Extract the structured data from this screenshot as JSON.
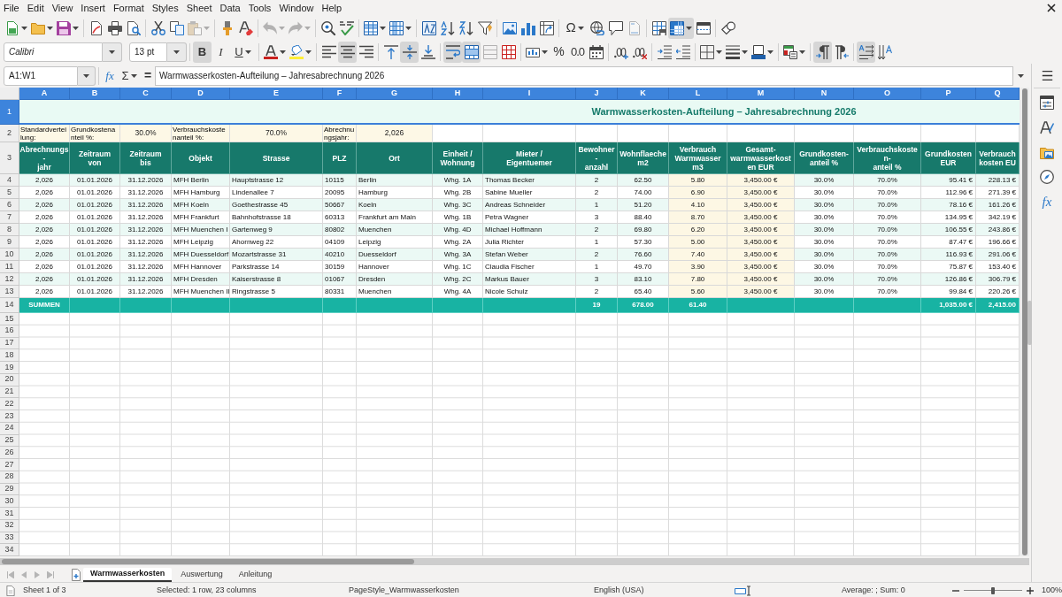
{
  "menu_bar": [
    "File",
    "Edit",
    "View",
    "Insert",
    "Format",
    "Styles",
    "Sheet",
    "Data",
    "Tools",
    "Window",
    "Help"
  ],
  "standard_toolbar": {
    "special_character_label": "Ω",
    "pressed": {
      "freeze_rows_columns": true
    },
    "disabled": {
      "paste": true,
      "undo": true,
      "redo": true,
      "header_footer": true
    }
  },
  "formatting_toolbar": {
    "font_name": "Calibri",
    "font_size": "13 pt",
    "bold_label": "B",
    "italic_label": "I",
    "underline_label": "U",
    "percent_label": "%",
    "number_label": "0.0",
    "pressed": {
      "bold": true,
      "italic": false,
      "underline": false,
      "align_left": false,
      "align_center": true,
      "align_right": false,
      "align_top": false,
      "align_middle": true,
      "align_bottom": false,
      "wrap_text": true,
      "merge_and_center": true,
      "left_to_right": true,
      "right_to_left": false,
      "text_horizontal": true,
      "text_vertical": false
    },
    "disabled": {
      "merge_cells": true
    }
  },
  "formula_bar": {
    "name_box": "A1:W1",
    "function_wizard_label": "fx",
    "sum_label": "Σ",
    "formula_label": "=",
    "content": "Warmwasserkosten-Aufteilung – Jahresabrechnung 2026"
  },
  "sidebar": {
    "functions_label": "fx"
  },
  "sheet": {
    "columns": [
      {
        "label": "A",
        "selected": true
      },
      {
        "label": "B",
        "selected": true
      },
      {
        "label": "C",
        "selected": true
      },
      {
        "label": "D",
        "selected": true
      },
      {
        "label": "E",
        "selected": true
      },
      {
        "label": "F",
        "selected": true
      },
      {
        "label": "G",
        "selected": true
      },
      {
        "label": "H",
        "selected": true
      },
      {
        "label": "I",
        "selected": true
      },
      {
        "label": "J",
        "selected": true
      },
      {
        "label": "K",
        "selected": true
      },
      {
        "label": "L",
        "selected": true
      },
      {
        "label": "M",
        "selected": true
      },
      {
        "label": "N",
        "selected": true
      },
      {
        "label": "O",
        "selected": true
      },
      {
        "label": "P",
        "selected": true
      },
      {
        "label": "Q",
        "selected": true
      }
    ],
    "row_headers": [
      {
        "label": "1",
        "selected": true
      },
      {
        "label": "2",
        "selected": false
      },
      {
        "label": "3",
        "selected": false
      },
      {
        "label": "4",
        "selected": false
      },
      {
        "label": "5",
        "selected": false
      },
      {
        "label": "6",
        "selected": false
      },
      {
        "label": "7",
        "selected": false
      },
      {
        "label": "8",
        "selected": false
      },
      {
        "label": "9",
        "selected": false
      },
      {
        "label": "10",
        "selected": false
      },
      {
        "label": "11",
        "selected": false
      },
      {
        "label": "12",
        "selected": false
      },
      {
        "label": "13",
        "selected": false
      },
      {
        "label": "14",
        "selected": false
      },
      {
        "label": "15",
        "selected": false
      },
      {
        "label": "16",
        "selected": false
      },
      {
        "label": "17",
        "selected": false
      },
      {
        "label": "18",
        "selected": false
      },
      {
        "label": "19",
        "selected": false
      },
      {
        "label": "20",
        "selected": false
      },
      {
        "label": "21",
        "selected": false
      },
      {
        "label": "22",
        "selected": false
      },
      {
        "label": "23",
        "selected": false
      },
      {
        "label": "24",
        "selected": false
      },
      {
        "label": "25",
        "selected": false
      },
      {
        "label": "26",
        "selected": false
      },
      {
        "label": "27",
        "selected": false
      },
      {
        "label": "28",
        "selected": false
      },
      {
        "label": "29",
        "selected": false
      },
      {
        "label": "30",
        "selected": false
      },
      {
        "label": "31",
        "selected": false
      },
      {
        "label": "32",
        "selected": false
      },
      {
        "label": "33",
        "selected": false
      },
      {
        "label": "34",
        "selected": false
      }
    ],
    "title": "Warmwasserkosten-Aufteilung – Jahresabrechnung 2026",
    "settings": [
      {
        "text": "Standardvertei\nlung:",
        "kind": "label"
      },
      {
        "text": "Grundkostena\nnteil %:",
        "kind": "label"
      },
      {
        "text": "30.0%",
        "kind": "value"
      },
      {
        "text": "Verbrauchskoste\nnanteil %:",
        "kind": "label"
      },
      {
        "text": "70.0%",
        "kind": "value"
      },
      {
        "text": "Abrechnu\nngsjahr:",
        "kind": "label"
      },
      {
        "text": "2,026",
        "kind": "value"
      }
    ],
    "header_row": [
      "Abrechnungs\n-\njahr",
      "Zeitraum\nvon",
      "Zeitraum\nbis",
      "Objekt",
      "Strasse",
      "PLZ",
      "Ort",
      "Einheit /\nWohnung",
      "Mieter /\nEigentuemer",
      "Bewohner\n-\nanzahl",
      "Wohnflaeche\nm2",
      "Verbrauch\nWarmwasser\nm3",
      "Gesamt-\nwarmwasserkost\nen EUR",
      "Grundkosten-\nanteil %",
      "Verbrauchskoste\nn-\nanteil %",
      "Grundkosten\nEUR",
      "Verbrauch\nkosten EU"
    ],
    "rows": [
      [
        "2,026",
        "01.01.2026",
        "31.12.2026",
        "MFH Berlin",
        "Hauptstrasse 12",
        "10115",
        "Berlin",
        "Whg. 1A",
        "Thomas Becker",
        "2",
        "62.50",
        "5.80",
        "3,450.00 €",
        "30.0%",
        "70.0%",
        "95.41 €",
        "228.13 €"
      ],
      [
        "2,026",
        "01.01.2026",
        "31.12.2026",
        "MFH Hamburg",
        "Lindenallee 7",
        "20095",
        "Hamburg",
        "Whg. 2B",
        "Sabine Mueller",
        "2",
        "74.00",
        "6.90",
        "3,450.00 €",
        "30.0%",
        "70.0%",
        "112.96 €",
        "271.39 €"
      ],
      [
        "2,026",
        "01.01.2026",
        "31.12.2026",
        "MFH Koeln",
        "Goethestrasse 45",
        "50667",
        "Koeln",
        "Whg. 3C",
        "Andreas Schneider",
        "1",
        "51.20",
        "4.10",
        "3,450.00 €",
        "30.0%",
        "70.0%",
        "78.16 €",
        "161.26 €"
      ],
      [
        "2,026",
        "01.01.2026",
        "31.12.2026",
        "MFH Frankfurt",
        "Bahnhofstrasse 18",
        "60313",
        "Frankfurt am Main",
        "Whg. 1B",
        "Petra Wagner",
        "3",
        "88.40",
        "8.70",
        "3,450.00 €",
        "30.0%",
        "70.0%",
        "134.95 €",
        "342.19 €"
      ],
      [
        "2,026",
        "01.01.2026",
        "31.12.2026",
        "MFH Muenchen I",
        "Gartenweg 9",
        "80802",
        "Muenchen",
        "Whg. 4D",
        "Michael Hoffmann",
        "2",
        "69.80",
        "6.20",
        "3,450.00 €",
        "30.0%",
        "70.0%",
        "106.55 €",
        "243.86 €"
      ],
      [
        "2,026",
        "01.01.2026",
        "31.12.2026",
        "MFH Leipzig",
        "Ahornweg 22",
        "04109",
        "Leipzig",
        "Whg. 2A",
        "Julia Richter",
        "1",
        "57.30",
        "5.00",
        "3,450.00 €",
        "30.0%",
        "70.0%",
        "87.47 €",
        "196.66 €"
      ],
      [
        "2,026",
        "01.01.2026",
        "31.12.2026",
        "MFH Duesseldorf",
        "Mozartstrasse 31",
        "40210",
        "Duesseldorf",
        "Whg. 3A",
        "Stefan Weber",
        "2",
        "76.60",
        "7.40",
        "3,450.00 €",
        "30.0%",
        "70.0%",
        "116.93 €",
        "291.06 €"
      ],
      [
        "2,026",
        "01.01.2026",
        "31.12.2026",
        "MFH Hannover",
        "Parkstrasse 14",
        "30159",
        "Hannover",
        "Whg. 1C",
        "Claudia Fischer",
        "1",
        "49.70",
        "3.90",
        "3,450.00 €",
        "30.0%",
        "70.0%",
        "75.87 €",
        "153.40 €"
      ],
      [
        "2,026",
        "01.01.2026",
        "31.12.2026",
        "MFH Dresden",
        "Kaiserstrasse 8",
        "01067",
        "Dresden",
        "Whg. 2C",
        "Markus Bauer",
        "3",
        "83.10",
        "7.80",
        "3,450.00 €",
        "30.0%",
        "70.0%",
        "126.86 €",
        "306.79 €"
      ],
      [
        "2,026",
        "01.01.2026",
        "31.12.2026",
        "MFH Muenchen II",
        "Ringstrasse 5",
        "80331",
        "Muenchen",
        "Whg. 4A",
        "Nicole Schulz",
        "2",
        "65.40",
        "5.60",
        "3,450.00 €",
        "30.0%",
        "70.0%",
        "99.84 €",
        "220.26 €"
      ]
    ],
    "totals": {
      "A": "SUMMEN",
      "J": "19",
      "K": "678.00",
      "L": "61.40",
      "P": "1,035.00 €",
      "Q": "2,415.00"
    }
  },
  "sheet_tabs": [
    {
      "label": "Warmwasserkosten",
      "selected": true
    },
    {
      "label": "Auswertung",
      "selected": false
    },
    {
      "label": "Anleitung",
      "selected": false
    }
  ],
  "status_bar": {
    "sheet": "Sheet 1 of 3",
    "selection": "Selected: 1 row, 23 columns",
    "page_style": "PageStyle_Warmwasserkosten",
    "language": "English (USA)",
    "summary": "Average: ; Sum: 0",
    "zoom_slider": {
      "level": 0.5
    },
    "zoom": "100%"
  }
}
